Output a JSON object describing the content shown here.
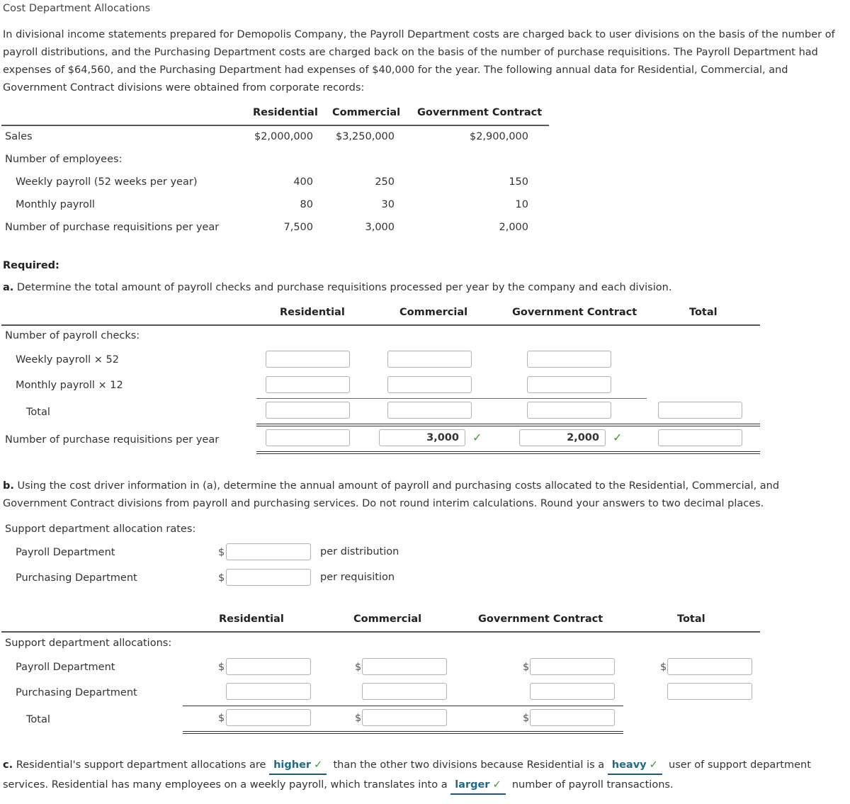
{
  "title": "Cost Department Allocations",
  "intro": "In divisional income statements prepared for Demopolis Company, the Payroll Department costs are charged back to user divisions on the basis of the number of payroll distributions, and the Purchasing Department costs are charged back on the basis of the number of purchase requisitions. The Payroll Department had expenses of $64,560, and the Purchasing Department had expenses of $40,000 for the year. The following annual data for Residential, Commercial, and Government Contract divisions were obtained from corporate records:",
  "data_table": {
    "headers": [
      "Residential",
      "Commercial",
      "Government Contract"
    ],
    "rows": [
      {
        "label": "Sales",
        "values": [
          "$2,000,000",
          "$3,250,000",
          "$2,900,000"
        ]
      },
      {
        "label": "Number of employees:",
        "values": [
          "",
          "",
          ""
        ]
      },
      {
        "label": "Weekly payroll (52 weeks per year)",
        "values": [
          "400",
          "250",
          "150"
        ]
      },
      {
        "label": "Monthly payroll",
        "values": [
          "80",
          "30",
          "10"
        ]
      },
      {
        "label": "Number of purchase requisitions per year",
        "values": [
          "7,500",
          "3,000",
          "2,000"
        ]
      }
    ]
  },
  "required_label": "Required:",
  "part_a": {
    "letter": "a.",
    "instruction": "Determine the total amount of payroll checks and purchase requisitions processed per year by the company and each division.",
    "headers": [
      "Residential",
      "Commercial",
      "Government Contract",
      "Total"
    ],
    "section_label": "Number of payroll checks:",
    "rows": {
      "weekly": {
        "label": "Weekly payroll × 52",
        "values": [
          "",
          "",
          ""
        ]
      },
      "monthly": {
        "label": "Monthly payroll × 12",
        "values": [
          "",
          "",
          ""
        ]
      },
      "total": {
        "label": "Total",
        "values": [
          "",
          "",
          "",
          ""
        ]
      },
      "requisitions": {
        "label": "Number of purchase requisitions per year",
        "values": [
          "",
          "3,000",
          "2,000",
          ""
        ],
        "correct": [
          false,
          true,
          true,
          false
        ]
      }
    }
  },
  "part_b": {
    "letter": "b.",
    "instruction": "Using the cost driver information in (a), determine the annual amount of payroll and purchasing costs allocated to the Residential, Commercial, and Government Contract divisions from payroll and purchasing services. Do not round interim calculations. Round your answers to two decimal places.",
    "rates_label": "Support department allocation rates:",
    "rates": [
      {
        "label": "Payroll Department",
        "currency": "$",
        "value": "",
        "unit": "per distribution"
      },
      {
        "label": "Purchasing Department",
        "currency": "$",
        "value": "",
        "unit": "per requisition"
      }
    ],
    "headers": [
      "Residential",
      "Commercial",
      "Government Contract",
      "Total"
    ],
    "section_label": "Support department allocations:",
    "rows": {
      "payroll": {
        "label": "Payroll Department",
        "currency": "$",
        "values": [
          "",
          "",
          "",
          ""
        ]
      },
      "purchasing": {
        "label": "Purchasing Department",
        "values": [
          "",
          "",
          "",
          ""
        ]
      },
      "total": {
        "label": "Total",
        "currency": "$",
        "values": [
          "",
          "",
          ""
        ]
      }
    }
  },
  "part_c": {
    "letter": "c.",
    "text1": "Residential's support department allocations are",
    "answer1": "higher",
    "text2": "than the other two divisions because Residential is a",
    "answer2": "heavy",
    "text3": "user of support department services. Residential has many employees on a weekly payroll, which translates into a",
    "answer3": "larger",
    "text4": "number of payroll transactions.",
    "check_symbol": "✓"
  },
  "colors": {
    "check": "#3a9a3a",
    "answer": "#1e6a8a"
  }
}
